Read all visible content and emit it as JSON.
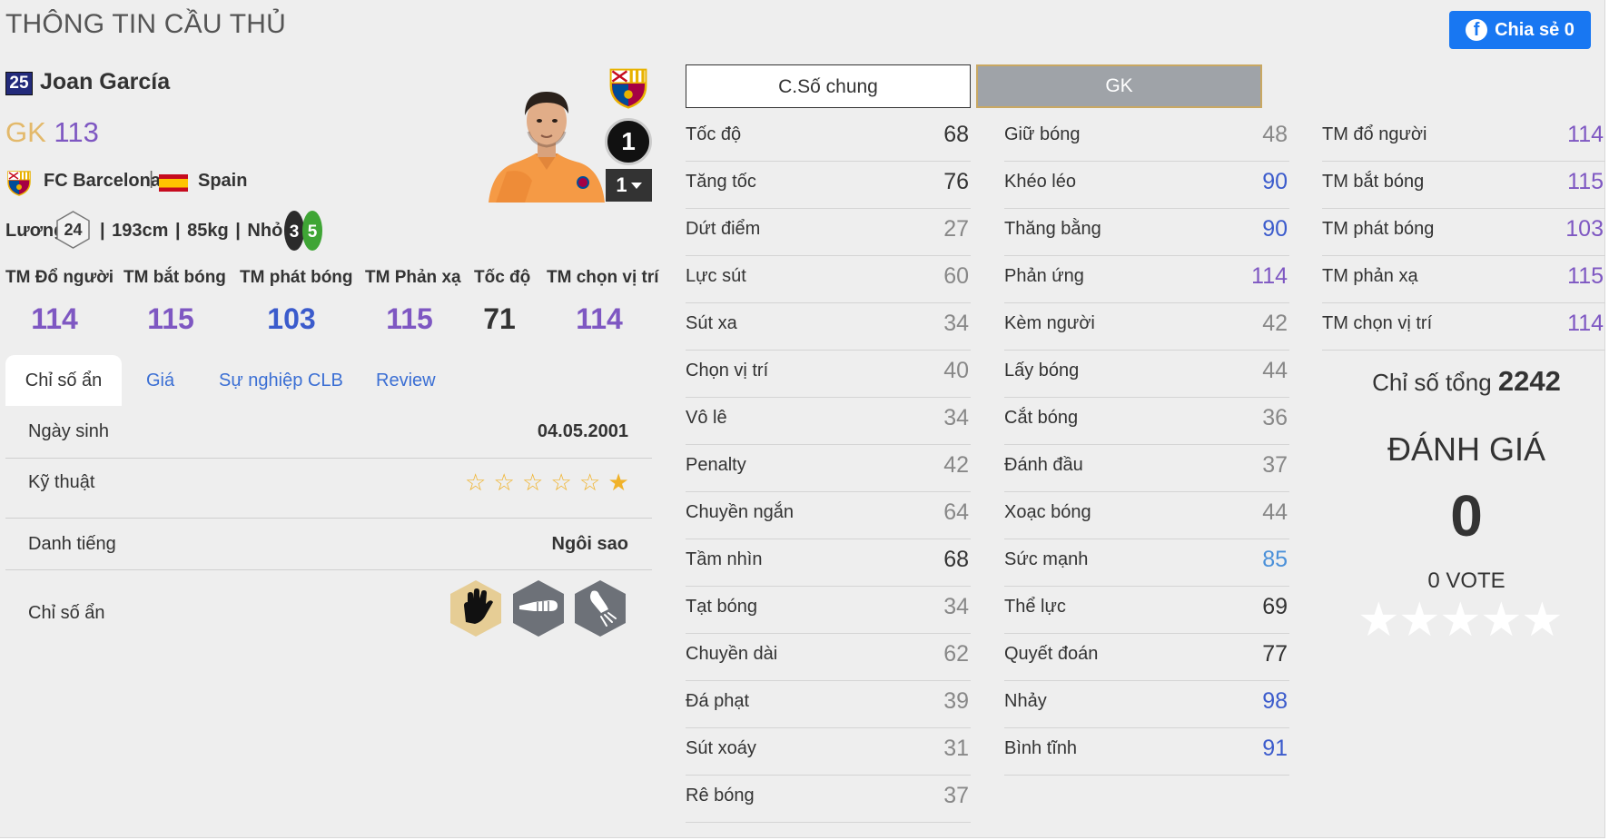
{
  "header": {
    "title": "THÔNG TIN CẦU THỦ",
    "share_label": "Chia sẻ 0"
  },
  "player": {
    "number": "25",
    "name": "Joan García",
    "position": "GK",
    "ovr": "113",
    "club": "FC Barcelona",
    "country": "Spain",
    "salary_label": "Lương",
    "salary": "24",
    "body_info": "| 193cm | 85kg | Nhỏ |",
    "weak_foot_left": "3",
    "weak_foot_right": "5",
    "level": "1",
    "level_select": "1"
  },
  "position_stats": [
    {
      "label": "TM Đổ người",
      "value": "114"
    },
    {
      "label": "TM bắt bóng",
      "value": "115"
    },
    {
      "label": "TM phát bóng",
      "value": "103"
    },
    {
      "label": "TM Phản xạ",
      "value": "115"
    },
    {
      "label": "Tốc độ",
      "value": "71"
    },
    {
      "label": "TM chọn vị trí",
      "value": "114"
    }
  ],
  "tabs": [
    {
      "label": "Chỉ số ẩn",
      "active": true
    },
    {
      "label": "Giá"
    },
    {
      "label": "Sự nghiệp CLB"
    },
    {
      "label": "Review"
    }
  ],
  "info": {
    "birth_label": "Ngày sinh",
    "birth_value": "04.05.2001",
    "skill_label": "Kỹ thuật",
    "skill_stars": 1,
    "skill_stars_max": 6,
    "fame_label": "Danh tiếng",
    "fame_value": "Ngôi sao",
    "traits_label": "Chỉ số ẩn",
    "trait_icons": [
      "goalkeeper-glove-gold-icon",
      "glove-punch-icon",
      "glove-throw-icon"
    ]
  },
  "modes": {
    "general": "C.Số chung",
    "gk": "GK"
  },
  "stat_columns": [
    [
      {
        "name": "Tốc độ",
        "value": "68"
      },
      {
        "name": "Tăng tốc",
        "value": "76"
      },
      {
        "name": "Dứt điểm",
        "value": "27"
      },
      {
        "name": "Lực sút",
        "value": "60"
      },
      {
        "name": "Sút xa",
        "value": "34"
      },
      {
        "name": "Chọn vị trí",
        "value": "40"
      },
      {
        "name": "Vô lê",
        "value": "34"
      },
      {
        "name": "Penalty",
        "value": "42"
      },
      {
        "name": "Chuyền ngắn",
        "value": "64"
      },
      {
        "name": "Tầm nhìn",
        "value": "68"
      },
      {
        "name": "Tạt bóng",
        "value": "34"
      },
      {
        "name": "Chuyền dài",
        "value": "62"
      },
      {
        "name": "Đá phạt",
        "value": "39"
      },
      {
        "name": "Sút xoáy",
        "value": "31"
      },
      {
        "name": "Rê bóng",
        "value": "37"
      }
    ],
    [
      {
        "name": "Giữ bóng",
        "value": "48"
      },
      {
        "name": "Khéo léo",
        "value": "90"
      },
      {
        "name": "Thăng bằng",
        "value": "90"
      },
      {
        "name": "Phản ứng",
        "value": "114"
      },
      {
        "name": "Kèm người",
        "value": "42"
      },
      {
        "name": "Lấy bóng",
        "value": "44"
      },
      {
        "name": "Cắt bóng",
        "value": "36"
      },
      {
        "name": "Đánh đầu",
        "value": "37"
      },
      {
        "name": "Xoạc bóng",
        "value": "44"
      },
      {
        "name": "Sức mạnh",
        "value": "85"
      },
      {
        "name": "Thể lực",
        "value": "69"
      },
      {
        "name": "Quyết đoán",
        "value": "77"
      },
      {
        "name": "Nhảy",
        "value": "98"
      },
      {
        "name": "Bình tĩnh",
        "value": "91"
      }
    ],
    [
      {
        "name": "TM đổ người",
        "value": "114"
      },
      {
        "name": "TM bắt bóng",
        "value": "115"
      },
      {
        "name": "TM phát bóng",
        "value": "103"
      },
      {
        "name": "TM phản xạ",
        "value": "115"
      },
      {
        "name": "TM chọn vị trí",
        "value": "114"
      }
    ]
  ],
  "summary": {
    "total_label": "Chỉ số tổng",
    "total_value": "2242",
    "rating_title": "ĐÁNH GIÁ",
    "rating_value": "0",
    "vote_label": "0 VOTE",
    "vote_stars": 5
  },
  "colors": {
    "gold": "#e3b96b",
    "purple": "#7e57c2",
    "blue": "#3b5bcc",
    "light_blue": "#4a90d9",
    "gray": "#888888",
    "dark": "#333333",
    "facebook": "#1877f2"
  }
}
